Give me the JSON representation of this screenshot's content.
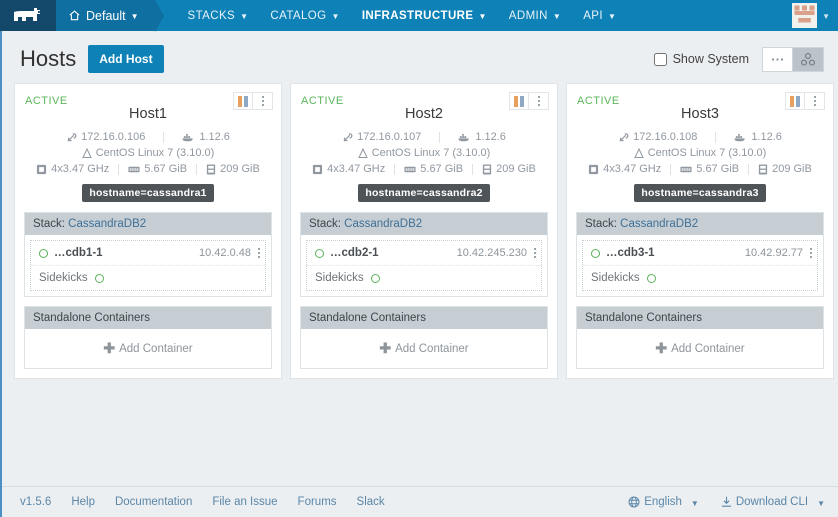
{
  "navbar": {
    "logo_icon": "rancher-cow-logo-icon",
    "environment": {
      "label": "Default",
      "icon": "home-icon",
      "caret": "⌄"
    },
    "items": [
      {
        "label": "STACKS",
        "active": false
      },
      {
        "label": "CATALOG",
        "active": false
      },
      {
        "label": "INFRASTRUCTURE",
        "active": true
      },
      {
        "label": "ADMIN",
        "active": false
      },
      {
        "label": "API",
        "active": false
      }
    ],
    "user": {
      "avatar_icon": "user-avatar-icon",
      "caret": "⌄"
    },
    "bg_color": "#0e82b7",
    "logo_bg_color": "#14486b"
  },
  "page": {
    "title": "Hosts",
    "add_host_label": "Add Host",
    "show_system": {
      "label": "Show System",
      "checked": false
    },
    "view_toggle": [
      {
        "name": "dots-view",
        "icon": "ellipsis-icon",
        "selected": false
      },
      {
        "name": "group-view",
        "icon": "cluster-icon",
        "selected": true
      }
    ]
  },
  "hosts": [
    {
      "state": "ACTIVE",
      "name": "Host1",
      "ip": "172.16.0.106",
      "docker_version": "1.12.6",
      "os": "CentOS Linux 7 (3.10.0)",
      "cpu": "4x3.47 GHz",
      "memory": "5.67 GiB",
      "disk": "209 GiB",
      "label_badge": "hostname=cassandra1",
      "stack": {
        "title_prefix": "Stack: ",
        "title_link": "CassandraDB2",
        "service": {
          "name": "…cdb1-1",
          "ip": "10.42.0.48",
          "state": "active"
        },
        "sidekicks_label": "Sidekicks"
      },
      "standalone": {
        "title": "Standalone Containers",
        "add_label": "Add Container"
      }
    },
    {
      "state": "ACTIVE",
      "name": "Host2",
      "ip": "172.16.0.107",
      "docker_version": "1.12.6",
      "os": "CentOS Linux 7 (3.10.0)",
      "cpu": "4x3.47 GHz",
      "memory": "5.67 GiB",
      "disk": "209 GiB",
      "label_badge": "hostname=cassandra2",
      "stack": {
        "title_prefix": "Stack: ",
        "title_link": "CassandraDB2",
        "service": {
          "name": "…cdb2-1",
          "ip": "10.42.245.230",
          "state": "active"
        },
        "sidekicks_label": "Sidekicks"
      },
      "standalone": {
        "title": "Standalone Containers",
        "add_label": "Add Container"
      }
    },
    {
      "state": "ACTIVE",
      "name": "Host3",
      "ip": "172.16.0.108",
      "docker_version": "1.12.6",
      "os": "CentOS Linux 7 (3.10.0)",
      "cpu": "4x3.47 GHz",
      "memory": "5.67 GiB",
      "disk": "209 GiB",
      "label_badge": "hostname=cassandra3",
      "stack": {
        "title_prefix": "Stack: ",
        "title_link": "CassandraDB2",
        "service": {
          "name": "…cdb3-1",
          "ip": "10.42.92.77",
          "state": "active"
        },
        "sidekicks_label": "Sidekicks"
      },
      "standalone": {
        "title": "Standalone Containers",
        "add_label": "Add Container"
      }
    }
  ],
  "footer": {
    "version": "v1.5.6",
    "links": [
      "Help",
      "Documentation",
      "File an Issue",
      "Forums",
      "Slack"
    ],
    "language": {
      "label": "English",
      "icon": "globe-icon",
      "caret": "⌄"
    },
    "download_cli": {
      "label": "Download CLI",
      "icon": "download-icon",
      "caret": "⌄"
    }
  },
  "colors": {
    "accent": "#0e82b7",
    "nav_dark": "#14486b",
    "active_green": "#5bb55b",
    "badge_gray": "#4f5459",
    "panel_head": "#c6ced4",
    "page_bg": "#eceff1"
  }
}
